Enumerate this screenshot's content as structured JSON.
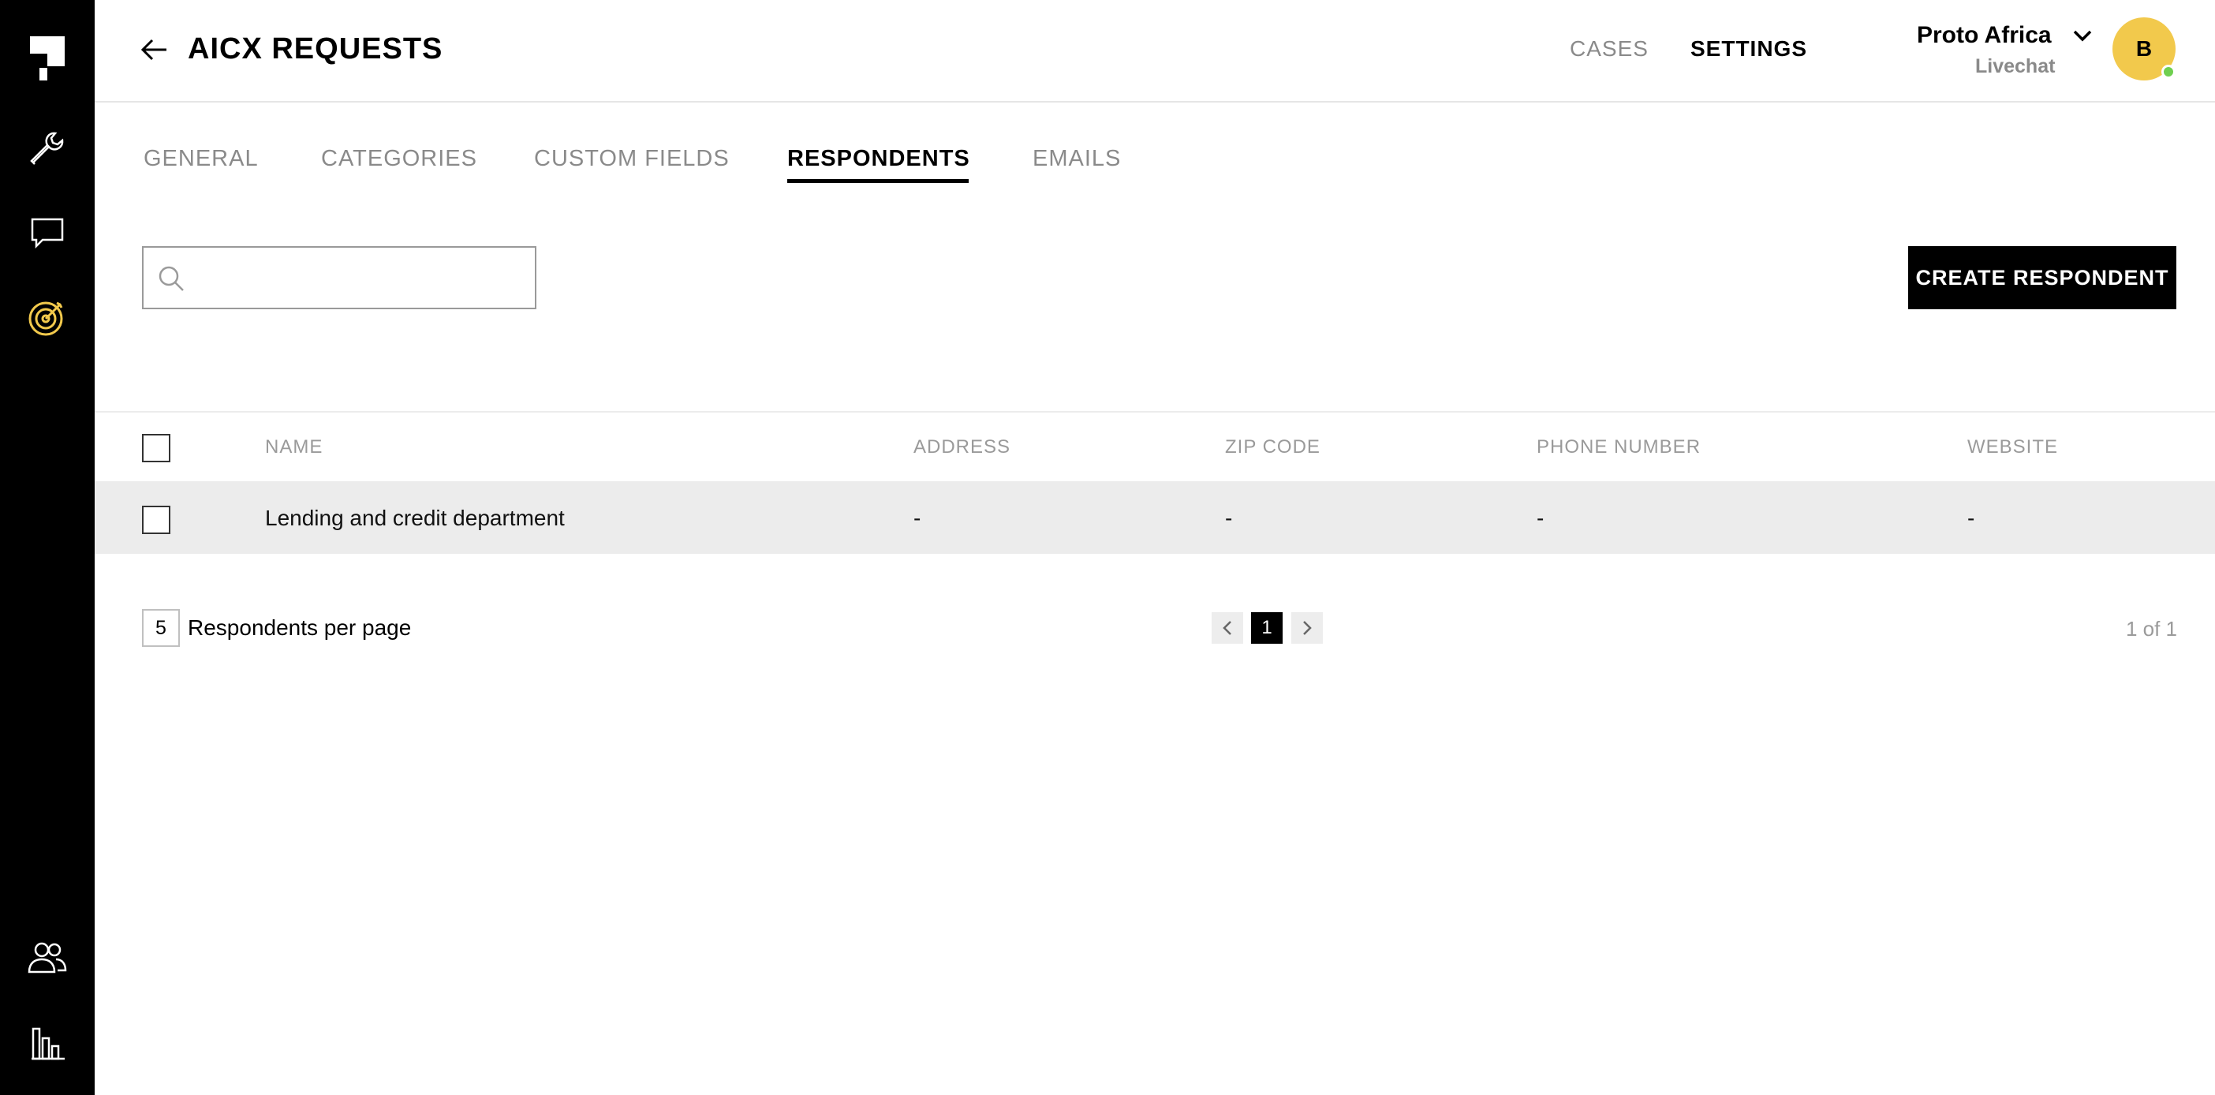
{
  "header": {
    "title": "AICX REQUESTS",
    "nav": {
      "cases": "CASES",
      "settings": "SETTINGS"
    },
    "org": {
      "name": "Proto Africa",
      "sub": "Livechat"
    },
    "avatar_initial": "B"
  },
  "sidebar": {
    "items": [
      "logo",
      "tools",
      "chat",
      "targets",
      "users",
      "analytics"
    ],
    "active_color": "#F2C94C"
  },
  "tabs": [
    {
      "label": "GENERAL"
    },
    {
      "label": "CATEGORIES"
    },
    {
      "label": "CUSTOM FIELDS"
    },
    {
      "label": "RESPONDENTS",
      "active": true
    },
    {
      "label": "EMAILS"
    }
  ],
  "search": {
    "placeholder": "",
    "value": ""
  },
  "create_button": "CREATE RESPONDENT",
  "table": {
    "columns": [
      "NAME",
      "ADDRESS",
      "ZIP CODE",
      "PHONE NUMBER",
      "WEBSITE"
    ],
    "rows": [
      [
        "Lending and credit department",
        "-",
        "-",
        "-",
        "-"
      ]
    ]
  },
  "pagination": {
    "per_page": "5",
    "per_page_label": "Respondents per page",
    "current_page": "1",
    "info": "1 of 1"
  },
  "colors": {
    "accent": "#F2C94C",
    "status_online": "#6FCF50",
    "row_highlight": "#ECECEC"
  }
}
